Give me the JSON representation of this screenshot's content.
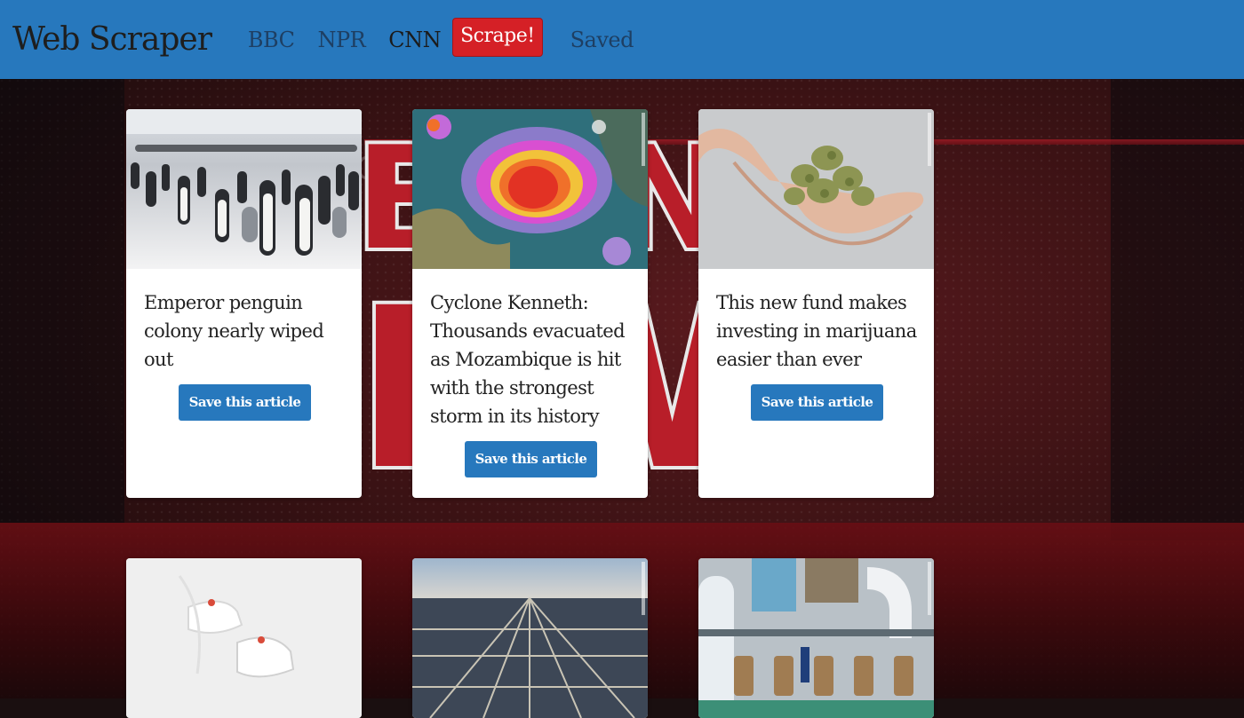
{
  "navbar": {
    "brand": "Web Scraper",
    "links": [
      "BBC",
      "NPR",
      "CNN"
    ],
    "scrape_label": "Scrape!",
    "saved_label": "Saved",
    "bg_color": "#2778bd",
    "scrape_color": "#d52026"
  },
  "articles": [
    {
      "title": "Emperor penguin colony nearly wiped out",
      "button": "Save this article",
      "image": "penguins-image"
    },
    {
      "title": "Cyclone Kenneth: Thousands evacuated as Mozambique is hit with the strongest storm in its history",
      "button": "Save this article",
      "image": "cyclone-radar-image"
    },
    {
      "title": "This new fund makes investing in marijuana easier than ever",
      "button": "Save this article",
      "image": "hand-cannabis-image"
    },
    {
      "title": "",
      "button": "",
      "image": "sneakers-image"
    },
    {
      "title": "",
      "button": "",
      "image": "solar-field-image"
    },
    {
      "title": "",
      "button": "",
      "image": "industrial-pipes-image"
    }
  ],
  "colors": {
    "button": "#2778bd",
    "card": "#ffffff"
  }
}
